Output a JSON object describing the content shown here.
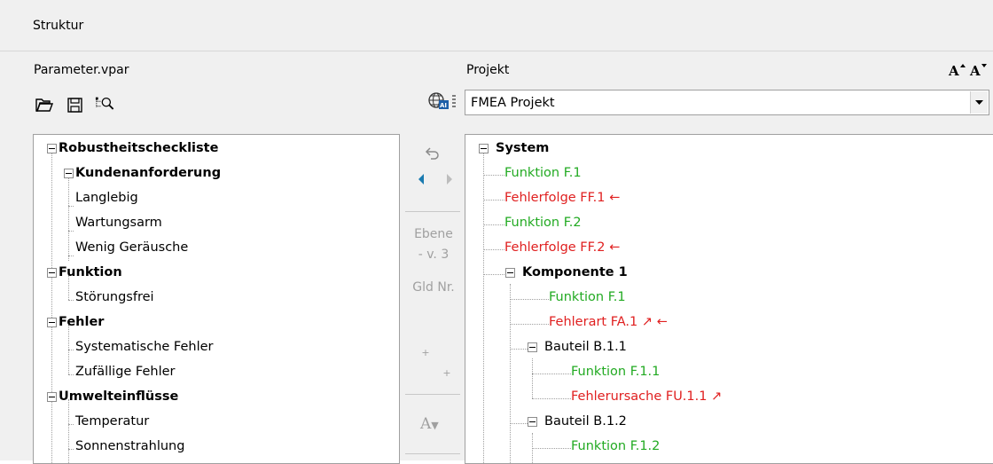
{
  "window": {
    "title": "Struktur"
  },
  "left": {
    "file_label": "Parameter.vpar",
    "tree": [
      {
        "label": "Robustheitscheckliste",
        "bold": true
      },
      {
        "label": "Kundenanforderung",
        "bold": true
      },
      {
        "label": "Langlebig"
      },
      {
        "label": "Wartungsarm"
      },
      {
        "label": "Wenig Geräusche"
      },
      {
        "label": "Funktion",
        "bold": true
      },
      {
        "label": "Störungsfrei"
      },
      {
        "label": "Fehler",
        "bold": true
      },
      {
        "label": "Systematische Fehler"
      },
      {
        "label": "Zufällige Fehler"
      },
      {
        "label": "Umwelteinflüsse",
        "bold": true
      },
      {
        "label": "Temperatur"
      },
      {
        "label": "Sonnenstrahlung"
      }
    ]
  },
  "middle": {
    "ebene_label": "Ebene",
    "ebene_value": "- v. 3",
    "gld_label": "Gld Nr.",
    "plus1": "+",
    "plus2": "+",
    "font_label": "A"
  },
  "right": {
    "project_label": "Projekt",
    "project_value": "FMEA Projekt",
    "tree": [
      {
        "label": "System",
        "bold": true
      },
      {
        "label": "Funktion F.1",
        "color": "green"
      },
      {
        "label": "Fehlerfolge FF.1 ←",
        "color": "red"
      },
      {
        "label": "Funktion F.2",
        "color": "green"
      },
      {
        "label": "Fehlerfolge FF.2 ←",
        "color": "red"
      },
      {
        "label": "Komponente 1",
        "bold": true
      },
      {
        "label": "Funktion F.1",
        "color": "green"
      },
      {
        "label": "Fehlerart FA.1 ↗ ←",
        "color": "red"
      },
      {
        "label": "Bauteil B.1.1"
      },
      {
        "label": "Funktion F.1.1",
        "color": "green"
      },
      {
        "label": "Fehlerursache FU.1.1 ↗",
        "color": "red"
      },
      {
        "label": "Bauteil B.1.2"
      },
      {
        "label": "Funktion F.1.2",
        "color": "green"
      }
    ]
  },
  "colors": {
    "green": "#22aa22",
    "red": "#e02020"
  }
}
